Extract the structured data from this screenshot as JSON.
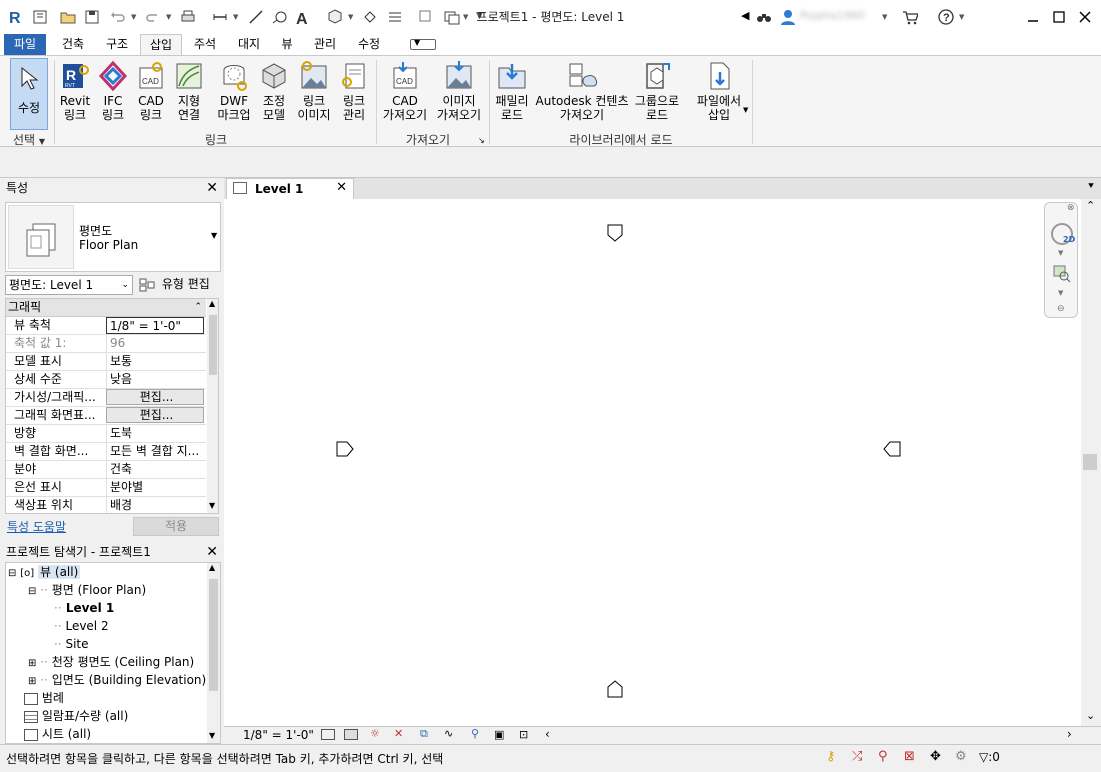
{
  "window": {
    "title": "프로젝트1 - 평면도: Level 1",
    "user_name": "Pojalta1960"
  },
  "ribbon_tabs": [
    "파일",
    "건축",
    "구조",
    "삽입",
    "주석",
    "대지",
    "뷰",
    "관리",
    "수정"
  ],
  "ribbon": {
    "select_label": "수정",
    "select_group": "선택",
    "buttons": [
      {
        "label": "Revit\n링크",
        "icon": "revit-link-icon"
      },
      {
        "label": "IFC\n링크",
        "icon": "ifc-link-icon"
      },
      {
        "label": "CAD\n링크",
        "icon": "cad-link-icon"
      },
      {
        "label": "지형\n연결",
        "icon": "topography-link-icon"
      },
      {
        "label": "DWF\n마크업",
        "icon": "dwf-markup-icon"
      },
      {
        "label": "조정\n모델",
        "icon": "coordination-model-icon"
      },
      {
        "label": "링크\n이미지",
        "icon": "link-image-icon"
      },
      {
        "label": "링크\n관리",
        "icon": "manage-links-icon"
      },
      {
        "label": "CAD\n가져오기",
        "icon": "import-cad-icon"
      },
      {
        "label": "이미지\n가져오기",
        "icon": "import-image-icon"
      },
      {
        "label": "패밀리\n로드",
        "icon": "load-family-icon"
      },
      {
        "label": "Autodesk 컨텐츠\n가져오기",
        "icon": "autodesk-content-icon"
      },
      {
        "label": "그룹으로\n로드",
        "icon": "load-as-group-icon"
      },
      {
        "label": "파일에서\n삽입",
        "icon": "insert-from-file-icon"
      }
    ],
    "groups": [
      "링크",
      "가져오기",
      "라이브러리에서 로드"
    ]
  },
  "properties": {
    "title": "특성",
    "type_name": "평면도",
    "type_sub": "Floor Plan",
    "instance_filter": "평면도: Level 1",
    "edit_type": "유형 편집",
    "category": "그래픽",
    "rows": [
      {
        "key": "뷰 축척",
        "value": "1/8\" = 1'-0\""
      },
      {
        "key": "축척 값    1:",
        "value": "96"
      },
      {
        "key": "모델 표시",
        "value": "보통"
      },
      {
        "key": "상세 수준",
        "value": "낮음"
      },
      {
        "key": "가시성/그래픽...",
        "value": "편집..."
      },
      {
        "key": "그래픽 화면표...",
        "value": "편집..."
      },
      {
        "key": "방향",
        "value": "도북"
      },
      {
        "key": "벽 결합 화면...",
        "value": "모든 벽 결합 지..."
      },
      {
        "key": "분야",
        "value": "건축"
      },
      {
        "key": "은선 표시",
        "value": "분야별"
      },
      {
        "key": "색상표 위치",
        "value": "배경"
      }
    ],
    "help_link": "특성 도움말",
    "apply": "적용"
  },
  "browser": {
    "title": "프로젝트 탐색기 - 프로젝트1",
    "nodes": [
      {
        "label": "뷰 (all)"
      },
      {
        "label": "평면 (Floor Plan)"
      },
      {
        "label": "Level 1"
      },
      {
        "label": "Level 2"
      },
      {
        "label": "Site"
      },
      {
        "label": "천장 평면도 (Ceiling Plan)"
      },
      {
        "label": "입면도 (Building Elevation)"
      },
      {
        "label": "범례"
      },
      {
        "label": "일람표/수량 (all)"
      },
      {
        "label": "시트 (all)"
      }
    ]
  },
  "view_tab": {
    "label": "Level 1"
  },
  "view_control": {
    "scale": "1/8\" = 1'-0\""
  },
  "status": {
    "message": "선택하려면 항목을 클릭하고, 다른 항목을 선택하려면 Tab 키, 추가하려면 Ctrl 키, 선택",
    "filter_count": ":0"
  },
  "colors": {
    "accent": "#2b67b5",
    "selected": "#c5daf3",
    "revit_blue": "#1f5fa8"
  }
}
